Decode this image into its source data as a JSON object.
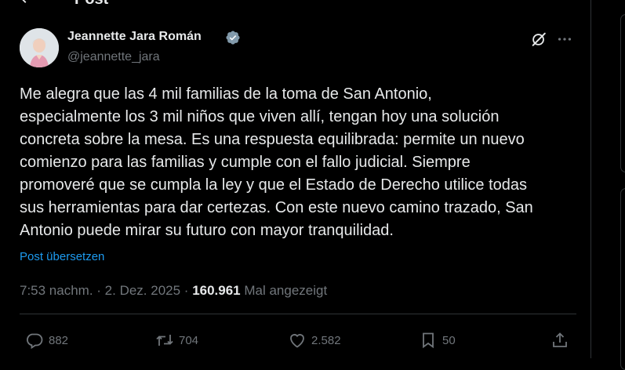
{
  "header": {
    "title": "Post"
  },
  "author": {
    "name": "Jeannette Jara Román",
    "handle": "@jeannette_jara",
    "verified": true
  },
  "tweet": {
    "text": "Me alegra que las 4 mil familias de la toma de San Antonio,\nespecialmente los 3 mil niños que viven allí, tengan hoy una solución\nconcreta sobre la mesa. Es una respuesta equilibrada: permite un nuevo\ncomienzo para las familias y cumple con el fallo judicial. Siempre\npromoveré que se cumpla la ley y que el Estado de Derecho utilice todas\nsus herramientas para dar certezas. Con este nuevo camino trazado, San\nAntonio puede mirar su futuro con mayor tranquilidad.",
    "translate_label": "Post übersetzen"
  },
  "meta": {
    "time": "7:53 nachm.",
    "separator": " · ",
    "date": "2. Dez. 2025",
    "views_separator": " · ",
    "views": "160.961",
    "views_label": " Mal angezeigt"
  },
  "actions": {
    "replies": "882",
    "reposts": "704",
    "likes": "2.582",
    "bookmarks": "50"
  },
  "colors": {
    "background": "#000000",
    "text": "#e7e9ea",
    "muted": "#71767b",
    "accent": "#1d9bf0",
    "border": "#2f3336"
  }
}
